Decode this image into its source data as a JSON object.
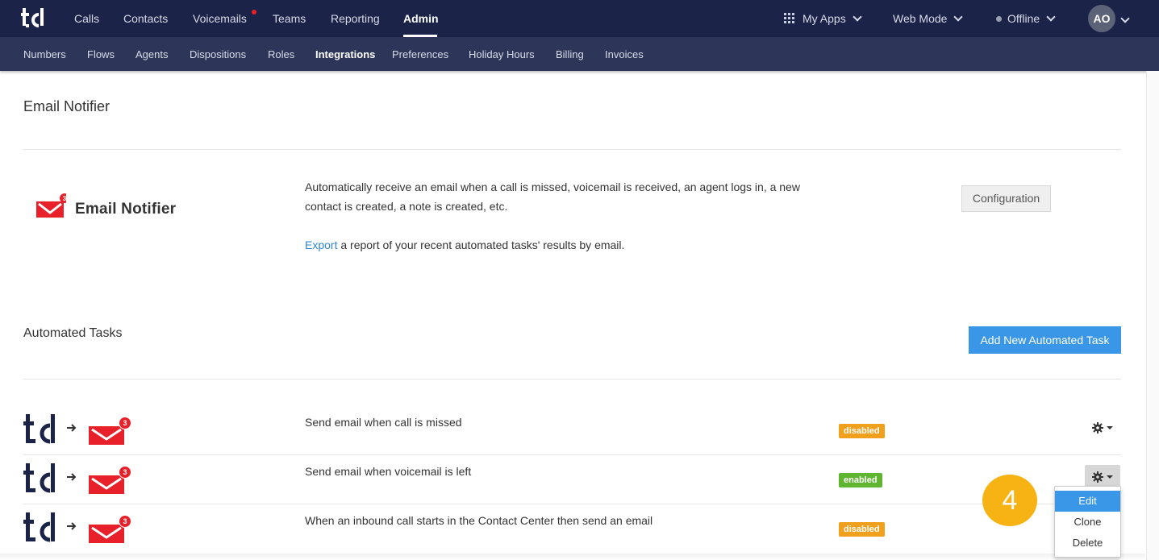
{
  "topnav": {
    "logo": "td-logo",
    "items": [
      {
        "label": "Calls"
      },
      {
        "label": "Contacts"
      },
      {
        "label": "Voicemails"
      },
      {
        "label": "Teams"
      },
      {
        "label": "Reporting"
      },
      {
        "label": "Admin"
      }
    ],
    "active": "Admin",
    "my_apps": "My Apps",
    "web_mode": "Web Mode",
    "status": "Offline",
    "avatar_initials": "AO"
  },
  "subnav": {
    "items": [
      {
        "label": "Numbers"
      },
      {
        "label": "Flows"
      },
      {
        "label": "Agents"
      },
      {
        "label": "Dispositions"
      },
      {
        "label": "Roles"
      },
      {
        "label": "Integrations"
      },
      {
        "label": "Preferences"
      },
      {
        "label": "Holiday Hours"
      },
      {
        "label": "Billing"
      },
      {
        "label": "Invoices"
      }
    ],
    "active": "Integrations"
  },
  "page": {
    "title": "Email Notifier",
    "brand_name": "Email Notifier",
    "brand_badge": "3",
    "description": "Automatically receive an email when a call is missed, voicemail is received, an agent logs in, a new contact is created, a note is created, etc.",
    "export_link": "Export",
    "export_text": " a report of your recent automated tasks' results by email.",
    "config_button": "Configuration"
  },
  "tasks_section": {
    "title": "Automated Tasks",
    "add_button": "Add New Automated Task",
    "tasks": [
      {
        "text": "Send email when call is missed",
        "status": "disabled",
        "badge": "3"
      },
      {
        "text": "Send email when voicemail is left",
        "status": "enabled",
        "badge": "3"
      },
      {
        "text": "When an inbound call starts in the Contact Center then send an email",
        "status": "disabled",
        "badge": "3"
      }
    ]
  },
  "step_marker": "4",
  "dropdown": {
    "items": [
      {
        "label": "Edit"
      },
      {
        "label": "Clone"
      },
      {
        "label": "Delete"
      }
    ],
    "highlighted": "Edit"
  },
  "colors": {
    "nav_bg": "#1b2348",
    "subnav_bg": "#2d3659",
    "primary": "#3a96e6",
    "disabled_badge": "#f0a01d",
    "enabled_badge": "#5fb430",
    "mail_red": "#e8202a",
    "step_marker": "#f7b314"
  }
}
